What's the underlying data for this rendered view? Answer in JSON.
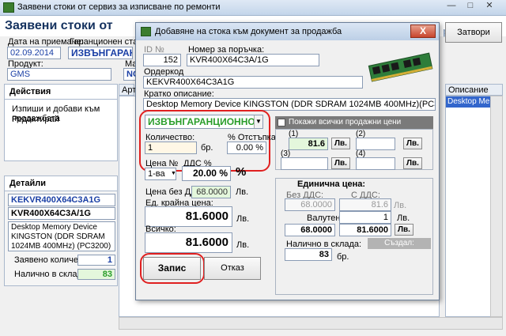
{
  "main": {
    "window_title": "Заявени стоки от сервиз за изписване по ремонти",
    "header_title": "Заявени стоки от",
    "labels": {
      "date": "Дата на приемане:",
      "warranty": "Гаранционен статус:",
      "product": "Продукт:",
      "col_m": "Ма"
    },
    "values": {
      "date": "02.09.2014",
      "warranty": "ИЗВЪНГАРАНЦИ",
      "product": "GMS",
      "col_n": "NC"
    },
    "actions_panel": {
      "title": "Действия",
      "items": [
        "Изпиши и добави към продажбата",
        "Редактирай"
      ]
    },
    "details_panel": {
      "title": "Детайли",
      "code1": "KEKVR400X64C3A1G",
      "code2": "KVR400X64C3A/1G",
      "description": "Desktop Memory Device KINGSTON (DDR SDRAM 1024MB 400MHz) (PC3200)",
      "requested_label": "Заявено количество:",
      "requested_value": "1",
      "stock_label": "Налично в склада:",
      "stock_value": "83"
    },
    "grid": {
      "col_art": "Арт",
      "col_desc": "Описание",
      "row_desc": "Desktop Memory De"
    },
    "right_button": "Затвори",
    "bg_fragment": "ре"
  },
  "dialog": {
    "title": "Добавяне на стока към документ за продажба",
    "close": "X",
    "id_label": "ID №",
    "id_value": "152",
    "order_label": "Номер за поръчка:",
    "order_value": "KVR400X64C3A/1G",
    "ordercode_label": "Ордеркод",
    "ordercode_value": "KEKVR400X64C3A1G",
    "short_desc_label": "Кратко описание:",
    "short_desc_value": "Desktop Memory Device KINGSTON (DDR SDRAM 1024MB 400MHz)(PC3200)",
    "status_value": "ИЗВЪНГАРАНЦИОННО",
    "qty_label": "Количество:",
    "qty_value": "1",
    "qty_unit": "бр.",
    "discount_label": "% Отстъпка",
    "discount_value": "0.00 %",
    "price_no_label": "Цена №",
    "price_no_value": "1-ва",
    "vat_label": "ДДС %",
    "vat_value": "20.00 %",
    "percent_sign": "%",
    "price_no_vat_label": "Цена без ДДС:",
    "price_no_vat_value": "68.0000",
    "unit_final_label": "Ед. крайна цена:",
    "unit_final_value": "81.6000",
    "total_label": "Всичко:",
    "total_value": "81.6000",
    "currency": "Лв.",
    "save_button": "Запис",
    "cancel_button": "Отказ",
    "show_all_prices": "Покажи всички продажни цени",
    "price_levels": [
      {
        "label": "(1)",
        "value": "81.6",
        "currency": "Лв."
      },
      {
        "label": "(2)",
        "value": "",
        "currency": "Лв."
      },
      {
        "label": "(3)",
        "value": "",
        "currency": "Лв."
      },
      {
        "label": "(4)",
        "value": "",
        "currency": "Лв."
      }
    ],
    "unit_price_group": "Единична цена:",
    "no_vat_label": "Без ДДС:",
    "with_vat_label": "С ДДС:",
    "no_vat_top": "68.0000",
    "with_vat_top": "81.6",
    "fx_label": "Валутен курс:",
    "fx_value": "1",
    "no_vat_value": "68.0000",
    "with_vat_value": "81.6000",
    "in_stock_label": "Налично в склада:",
    "in_stock_value": "83",
    "created_button": "Създал:"
  },
  "colors": {
    "status_text": "#2a9d2a",
    "highlight_ring": "#e02020",
    "price_field_bg": "#e4f7dc",
    "header_blue": "#1a3fa5"
  }
}
